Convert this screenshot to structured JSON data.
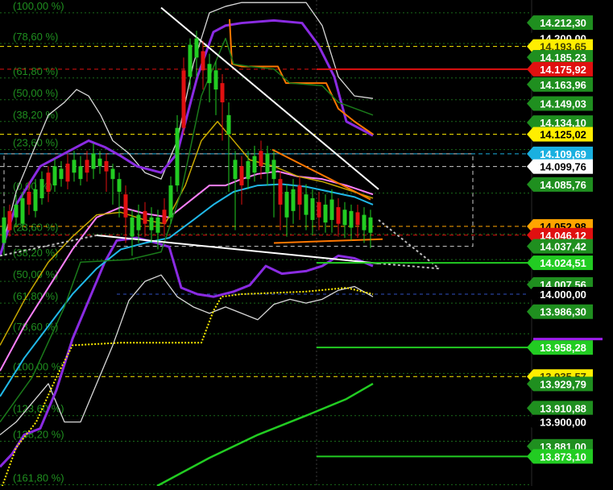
{
  "chart_data": {
    "type": "candlestick",
    "background": "#000000",
    "ylim": [
      13850,
      14230
    ],
    "fib_levels": [
      {
        "label": "(100,00 %)",
        "value": 14220
      },
      {
        "label": "(78,60 %)",
        "value": 14196
      },
      {
        "label": "(61,80 %)",
        "value": 14169
      },
      {
        "label": "(50,00 %)",
        "value": 14152
      },
      {
        "label": "(38,20 %)",
        "value": 14135
      },
      {
        "label": "(23,60 %)",
        "value": 14113
      },
      {
        "label": "(0,00 %)",
        "value": 14079
      },
      {
        "label": "(23,60 %)",
        "value": 14047
      },
      {
        "label": "(38,20 %)",
        "value": 14027
      },
      {
        "label": "(50,00 %)",
        "value": 14010
      },
      {
        "label": "(61,80 %)",
        "value": 13993
      },
      {
        "label": "(78,60 %)",
        "value": 13969
      },
      {
        "label": "(100,00 %)",
        "value": 13938
      },
      {
        "label": "(123,60 %)",
        "value": 13905
      },
      {
        "label": "(138,20 %)",
        "value": 13885
      },
      {
        "label": "(161,80 %)",
        "value": 13851
      }
    ],
    "price_tags": [
      {
        "text": "14.212,30",
        "value": 14212.3,
        "bg": "#1f8f1f",
        "fg": "#ffffff"
      },
      {
        "text": "14.200,00",
        "value": 14200.0,
        "bg": "#000000",
        "fg": "#ffffff"
      },
      {
        "text": "14.193,65",
        "value": 14193.65,
        "bg": "#ffee00",
        "fg": "#444400"
      },
      {
        "text": "14.185,23",
        "value": 14185.23,
        "bg": "#1f8f1f",
        "fg": "#ffffff"
      },
      {
        "text": "14.175,92",
        "value": 14175.92,
        "bg": "#e01010",
        "fg": "#ffffff"
      },
      {
        "text": "14.163,96",
        "value": 14163.96,
        "bg": "#1f8f1f",
        "fg": "#ffffff"
      },
      {
        "text": "14.149,03",
        "value": 14149.03,
        "bg": "#1f8f1f",
        "fg": "#ffffff"
      },
      {
        "text": "14.134,10",
        "value": 14134.1,
        "bg": "#1f8f1f",
        "fg": "#ffffff"
      },
      {
        "text": "14.125,02",
        "value": 14125.02,
        "bg": "#ffee00",
        "fg": "#000000"
      },
      {
        "text": "14.109,69",
        "value": 14109.69,
        "bg": "#1ab0e0",
        "fg": "#ffffff"
      },
      {
        "text": "14.099,76",
        "value": 14099.76,
        "bg": "#ffffff",
        "fg": "#000000"
      },
      {
        "text": "14.085,76",
        "value": 14085.76,
        "bg": "#1f8f1f",
        "fg": "#ffffff"
      },
      {
        "text": "14.052,98",
        "value": 14052.98,
        "bg": "#ffa500",
        "fg": "#000000"
      },
      {
        "text": "14.046,12",
        "value": 14046.12,
        "bg": "#e01010",
        "fg": "#ffffff"
      },
      {
        "text": "14.037,42",
        "value": 14037.42,
        "bg": "#1f8f1f",
        "fg": "#ffffff"
      },
      {
        "text": "14.024,51",
        "value": 14024.51,
        "bg": "#22cc22",
        "fg": "#ffffff"
      },
      {
        "text": "14.007,56",
        "value": 14007.56,
        "bg": "#1f8f1f",
        "fg": "#ffffff"
      },
      {
        "text": "14.000,00",
        "value": 14000.0,
        "bg": "#000000",
        "fg": "#ffffff"
      },
      {
        "text": "13.986,30",
        "value": 13986.3,
        "bg": "#1f8f1f",
        "fg": "#ffffff"
      },
      {
        "text": "13.958,28",
        "value": 13958.28,
        "bg": "#22cc22",
        "fg": "#ffffff"
      },
      {
        "text": "13.935,57",
        "value": 13935.57,
        "bg": "#ffee00",
        "fg": "#444400"
      },
      {
        "text": "13.929,79",
        "value": 13929.79,
        "bg": "#1f8f1f",
        "fg": "#ffffff"
      },
      {
        "text": "13.910,88",
        "value": 13910.88,
        "bg": "#1f8f1f",
        "fg": "#ffffff"
      },
      {
        "text": "13.900,00",
        "value": 13900.0,
        "bg": "#000000",
        "fg": "#ffffff"
      },
      {
        "text": "13.881,00",
        "value": 13881.0,
        "bg": "#1f8f1f",
        "fg": "#ffffff"
      },
      {
        "text": "13.873,10",
        "value": 13873.1,
        "bg": "#22cc22",
        "fg": "#ffffff"
      }
    ],
    "series_colors": {
      "bollinger_outer": "#d8d8d8",
      "bollinger_band": "#8a2be2",
      "ema_fast": "#ff80ff",
      "ema_mid": "#c8a800",
      "ema_slow": "#20b8e8",
      "trend_green": "#22cc22",
      "support_yellow": "#ffee00",
      "resistance_orange": "#ff7700",
      "resistance_red": "#e01010",
      "candle_up": "#22cc22",
      "candle_down": "#e01010",
      "fib_label": "#1f8f1f"
    }
  }
}
